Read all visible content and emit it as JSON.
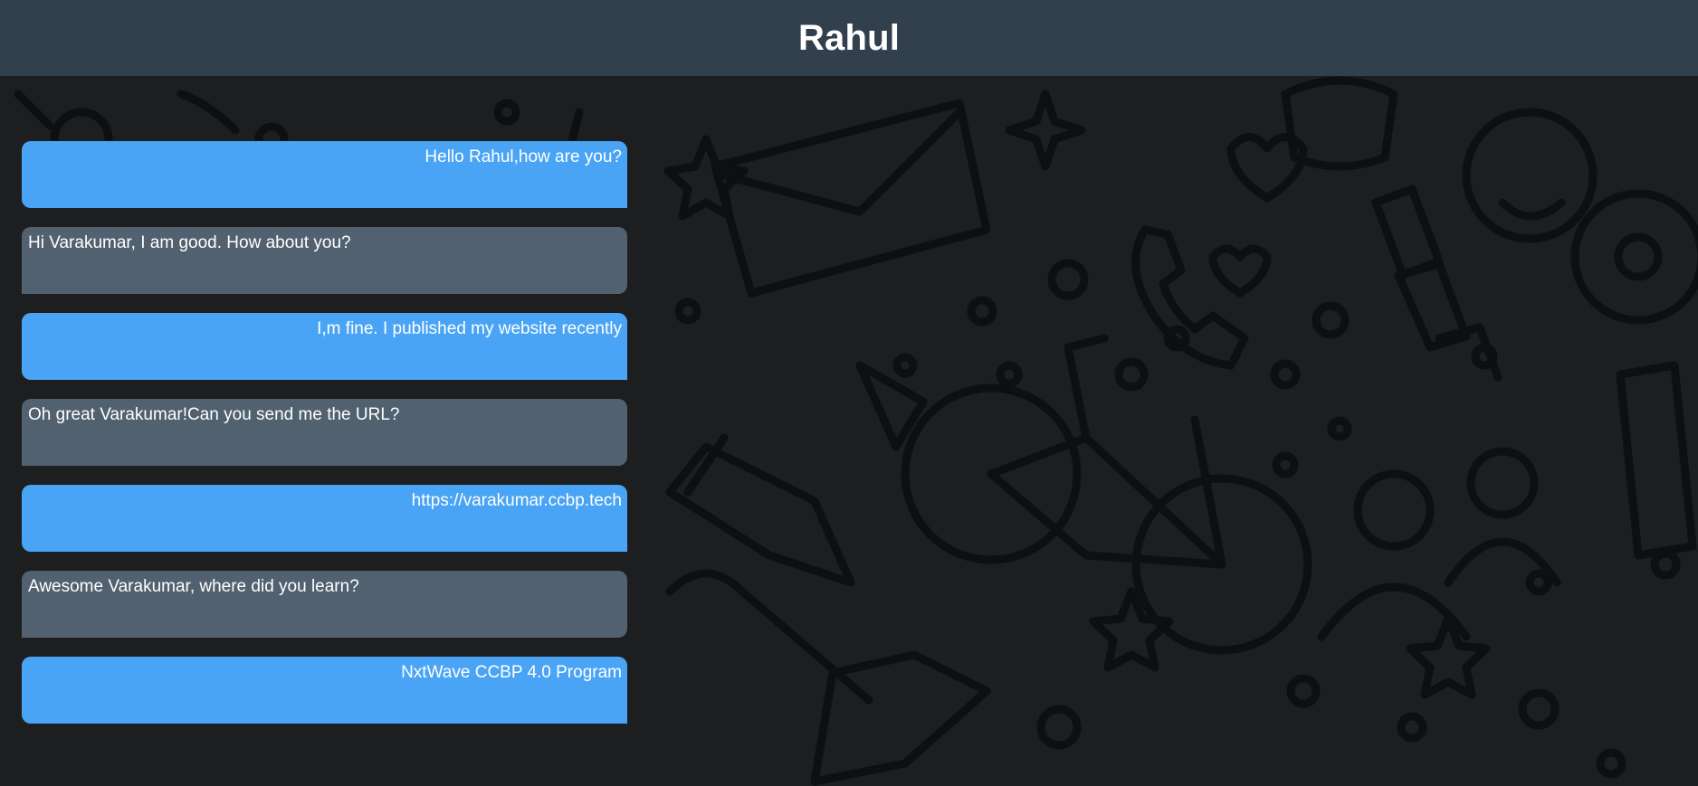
{
  "header": {
    "title": "Rahul"
  },
  "colors": {
    "header_bg": "#323f4d",
    "sent_bubble": "#4aa4f5",
    "received_bubble": "#526170",
    "wallpaper_bg": "#1d1e1f",
    "text": "#ffffff"
  },
  "wallpaper": {
    "icon": "doodle-pattern-icon"
  },
  "messages": [
    {
      "direction": "sent",
      "text": "Hello Rahul,how are you?"
    },
    {
      "direction": "received",
      "text": "Hi Varakumar, I am good. How about you?"
    },
    {
      "direction": "sent",
      "text": "I,m fine. I published my website recently"
    },
    {
      "direction": "received",
      "text": "Oh great Varakumar!Can you send me the URL?"
    },
    {
      "direction": "sent",
      "text": "https://varakumar.ccbp.tech"
    },
    {
      "direction": "received",
      "text": "Awesome Varakumar, where did you learn?"
    },
    {
      "direction": "sent",
      "text": "NxtWave CCBP 4.0 Program"
    }
  ]
}
